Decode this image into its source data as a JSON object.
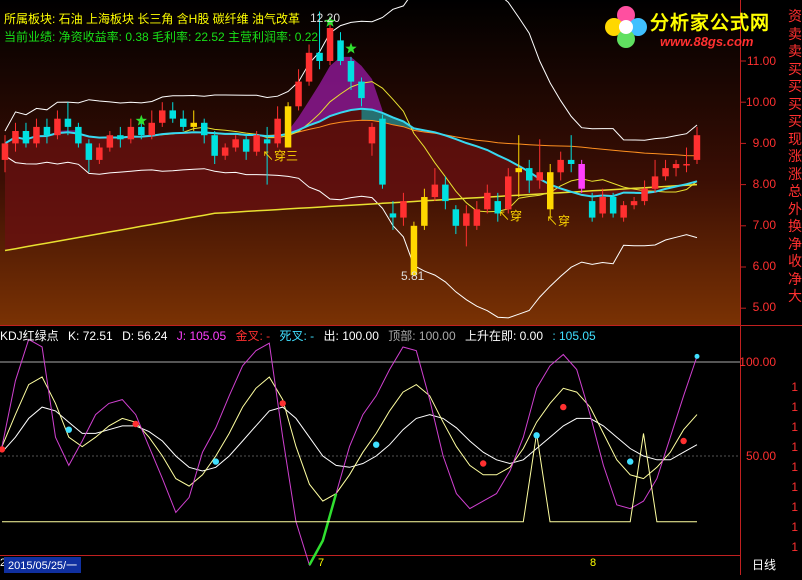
{
  "info": {
    "line1": "所属板块: 石油 上海板块 长三角 含H股 碳纤维 油气改革",
    "line2": "当前业绩: 净资收益率: 0.38 毛利率: 22.52 主营利润率: 0.22"
  },
  "logo": {
    "title": "分析家公式网",
    "url": "www.88gs.com",
    "icon": "flower-logo-icon"
  },
  "price_axis": [
    "11.00",
    "10.00",
    "9.00",
    "8.00",
    "7.00",
    "6.00",
    "5.00"
  ],
  "price_annotations": {
    "high": "12.20",
    "low": "5.81",
    "cross_1": "穿三",
    "cross_2": "穿",
    "cross_3": "穿"
  },
  "side_chars": [
    "资",
    "卖",
    "卖",
    "买",
    "买",
    "买",
    "买",
    "现",
    "涨",
    "涨",
    "总",
    "外",
    "换",
    "净",
    "收",
    "净",
    "大"
  ],
  "kdj_header": {
    "name": "KDJ红绿点",
    "k": "K: 72.51",
    "d": "D: 56.24",
    "j": "J: 105.05",
    "golden": "金叉: -",
    "dead": "死叉: -",
    "out": "出: 100.00",
    "top": "顶部: 100.00",
    "rising": "上升在即: 0.00",
    "extra": ": 105.05"
  },
  "kdj_axis": [
    "100.00",
    "50.00"
  ],
  "kdj_axis_small": [
    "1",
    "1",
    "1",
    "1",
    "1",
    "1",
    "1",
    "1",
    "1"
  ],
  "dates": {
    "current": "2015/05/25/一",
    "mark_a": "7",
    "mark_b": "8",
    "mark_left": "2"
  },
  "period": "日线",
  "colors": {
    "up": "#ff3030",
    "down": "#00e0e0",
    "yellow_bar": "#ffd800",
    "magenta": "#ff40ff",
    "band": "#ffffff",
    "ma_cyan": "#38d8f0",
    "ma_yellow": "#e8e030",
    "ma_orange": "#ff9020",
    "fill_dark_red": "#6a1010",
    "fill_purple": "#8a1890",
    "fill_teal": "#1a8a8a"
  },
  "chart_data": {
    "type": "candlestick",
    "ylim": [
      4.3,
      12.6
    ],
    "candles": [
      {
        "o": 8.6,
        "c": 9.0,
        "h": 9.2,
        "l": 8.3
      },
      {
        "o": 9.0,
        "c": 9.3,
        "h": 9.5,
        "l": 8.8
      },
      {
        "o": 9.3,
        "c": 9.0,
        "h": 9.5,
        "l": 8.9
      },
      {
        "o": 9.0,
        "c": 9.4,
        "h": 9.6,
        "l": 8.9
      },
      {
        "o": 9.4,
        "c": 9.2,
        "h": 9.6,
        "l": 9.0
      },
      {
        "o": 9.2,
        "c": 9.6,
        "h": 9.8,
        "l": 9.1
      },
      {
        "o": 9.6,
        "c": 9.4,
        "h": 10.0,
        "l": 9.2
      },
      {
        "o": 9.4,
        "c": 9.0,
        "h": 9.5,
        "l": 8.9
      },
      {
        "o": 9.0,
        "c": 8.6,
        "h": 9.1,
        "l": 8.3
      },
      {
        "o": 8.6,
        "c": 8.9,
        "h": 9.0,
        "l": 8.5
      },
      {
        "o": 8.9,
        "c": 9.2,
        "h": 9.3,
        "l": 8.8
      },
      {
        "o": 9.2,
        "c": 9.1,
        "h": 9.4,
        "l": 8.9
      },
      {
        "o": 9.1,
        "c": 9.4,
        "h": 9.6,
        "l": 9.0
      },
      {
        "o": 9.4,
        "c": 9.2,
        "h": 9.6,
        "l": 9.1
      },
      {
        "o": 9.2,
        "c": 9.5,
        "h": 9.8,
        "l": 9.1
      },
      {
        "o": 9.5,
        "c": 9.8,
        "h": 10.0,
        "l": 9.4
      },
      {
        "o": 9.8,
        "c": 9.6,
        "h": 10.0,
        "l": 9.5
      },
      {
        "o": 9.6,
        "c": 9.4,
        "h": 9.8,
        "l": 9.3
      },
      {
        "o": 9.4,
        "c": 9.5,
        "h": 9.8,
        "l": 9.3
      },
      {
        "o": 9.5,
        "c": 9.2,
        "h": 9.6,
        "l": 9.0
      },
      {
        "o": 9.2,
        "c": 8.7,
        "h": 9.3,
        "l": 8.5
      },
      {
        "o": 8.7,
        "c": 8.9,
        "h": 9.0,
        "l": 8.6
      },
      {
        "o": 8.9,
        "c": 9.1,
        "h": 9.2,
        "l": 8.8
      },
      {
        "o": 9.1,
        "c": 8.8,
        "h": 9.2,
        "l": 8.6
      },
      {
        "o": 8.8,
        "c": 9.2,
        "h": 9.3,
        "l": 8.7
      },
      {
        "o": 9.1,
        "c": 9.0,
        "h": 9.4,
        "l": 8.0
      },
      {
        "o": 9.0,
        "c": 9.6,
        "h": 9.9,
        "l": 8.9
      },
      {
        "o": 8.9,
        "c": 9.9,
        "h": 10.0,
        "l": 8.9
      },
      {
        "o": 9.9,
        "c": 10.5,
        "h": 10.8,
        "l": 9.8
      },
      {
        "o": 10.5,
        "c": 11.2,
        "h": 11.4,
        "l": 10.4
      },
      {
        "o": 11.2,
        "c": 11.0,
        "h": 12.2,
        "l": 10.8
      },
      {
        "o": 11.0,
        "c": 11.8,
        "h": 12.0,
        "l": 10.9
      },
      {
        "o": 11.5,
        "c": 11.0,
        "h": 11.7,
        "l": 10.9
      },
      {
        "o": 11.0,
        "c": 10.5,
        "h": 11.1,
        "l": 10.3
      },
      {
        "o": 10.5,
        "c": 10.1,
        "h": 10.6,
        "l": 9.9
      },
      {
        "o": 9.0,
        "c": 9.4,
        "h": 9.5,
        "l": 8.7
      },
      {
        "o": 9.6,
        "c": 8.0,
        "h": 9.7,
        "l": 7.9
      },
      {
        "o": 7.3,
        "c": 7.2,
        "h": 7.6,
        "l": 6.9
      },
      {
        "o": 7.2,
        "c": 7.6,
        "h": 7.8,
        "l": 7.0
      },
      {
        "o": 7.0,
        "c": 5.8,
        "h": 7.1,
        "l": 5.8
      },
      {
        "o": 7.0,
        "c": 7.7,
        "h": 7.9,
        "l": 6.9
      },
      {
        "o": 7.7,
        "c": 8.0,
        "h": 8.4,
        "l": 7.6
      },
      {
        "o": 8.0,
        "c": 7.6,
        "h": 8.2,
        "l": 7.4
      },
      {
        "o": 7.4,
        "c": 7.0,
        "h": 7.5,
        "l": 6.8
      },
      {
        "o": 7.0,
        "c": 7.3,
        "h": 7.5,
        "l": 6.5
      },
      {
        "o": 7.0,
        "c": 7.4,
        "h": 7.6,
        "l": 6.9
      },
      {
        "o": 7.4,
        "c": 7.8,
        "h": 8.0,
        "l": 7.3
      },
      {
        "o": 7.6,
        "c": 7.3,
        "h": 7.8,
        "l": 7.1
      },
      {
        "o": 7.4,
        "c": 8.2,
        "h": 8.4,
        "l": 7.3
      },
      {
        "o": 8.3,
        "c": 8.4,
        "h": 9.2,
        "l": 7.7
      },
      {
        "o": 8.4,
        "c": 8.1,
        "h": 8.6,
        "l": 7.8
      },
      {
        "o": 8.1,
        "c": 8.3,
        "h": 9.1,
        "l": 7.9
      },
      {
        "o": 7.4,
        "c": 8.3,
        "h": 8.5,
        "l": 7.2
      },
      {
        "o": 8.3,
        "c": 8.6,
        "h": 8.8,
        "l": 8.1
      },
      {
        "o": 8.6,
        "c": 8.5,
        "h": 9.2,
        "l": 8.3
      },
      {
        "o": 8.5,
        "c": 7.9,
        "h": 8.6,
        "l": 7.8
      },
      {
        "o": 7.6,
        "c": 7.2,
        "h": 7.8,
        "l": 7.1
      },
      {
        "o": 7.3,
        "c": 7.7,
        "h": 7.9,
        "l": 7.2
      },
      {
        "o": 7.7,
        "c": 7.3,
        "h": 7.8,
        "l": 7.2
      },
      {
        "o": 7.2,
        "c": 7.5,
        "h": 7.6,
        "l": 7.1
      },
      {
        "o": 7.5,
        "c": 7.6,
        "h": 7.7,
        "l": 7.4
      },
      {
        "o": 7.6,
        "c": 7.9,
        "h": 8.1,
        "l": 7.5
      },
      {
        "o": 7.9,
        "c": 8.2,
        "h": 8.6,
        "l": 7.8
      },
      {
        "o": 8.2,
        "c": 8.4,
        "h": 8.6,
        "l": 8.1
      },
      {
        "o": 8.4,
        "c": 8.5,
        "h": 8.6,
        "l": 8.2
      },
      {
        "o": 8.5,
        "c": 8.5,
        "h": 8.9,
        "l": 8.3
      },
      {
        "o": 8.6,
        "c": 9.2,
        "h": 9.4,
        "l": 8.5
      }
    ],
    "kdj": {
      "ylim": [
        -10,
        130
      ],
      "j_series": [
        55,
        90,
        112,
        108,
        60,
        45,
        58,
        72,
        78,
        80,
        72,
        55,
        38,
        20,
        28,
        52,
        65,
        82,
        98,
        106,
        110,
        60,
        15,
        -8,
        5,
        30,
        55,
        72,
        82,
        96,
        108,
        106,
        80,
        50,
        30,
        22,
        26,
        30,
        42,
        60,
        86,
        98,
        104,
        96,
        72,
        45,
        24,
        22,
        26,
        38,
        60,
        82,
        103
      ],
      "k_series": [
        55,
        72,
        88,
        92,
        78,
        60,
        55,
        60,
        66,
        70,
        68,
        60,
        50,
        38,
        34,
        40,
        50,
        62,
        76,
        86,
        92,
        80,
        55,
        35,
        26,
        30,
        40,
        52,
        62,
        74,
        84,
        88,
        82,
        68,
        55,
        45,
        40,
        40,
        44,
        54,
        68,
        78,
        86,
        84,
        76,
        62,
        48,
        40,
        38,
        44,
        52,
        64,
        72
      ],
      "d_series": [
        52,
        60,
        70,
        76,
        74,
        68,
        62,
        62,
        64,
        66,
        66,
        63,
        58,
        50,
        44,
        42,
        44,
        50,
        58,
        66,
        74,
        76,
        70,
        60,
        50,
        45,
        44,
        46,
        50,
        56,
        64,
        70,
        72,
        70,
        65,
        58,
        52,
        48,
        46,
        48,
        54,
        60,
        66,
        70,
        70,
        66,
        60,
        54,
        50,
        48,
        48,
        52,
        56
      ]
    }
  }
}
